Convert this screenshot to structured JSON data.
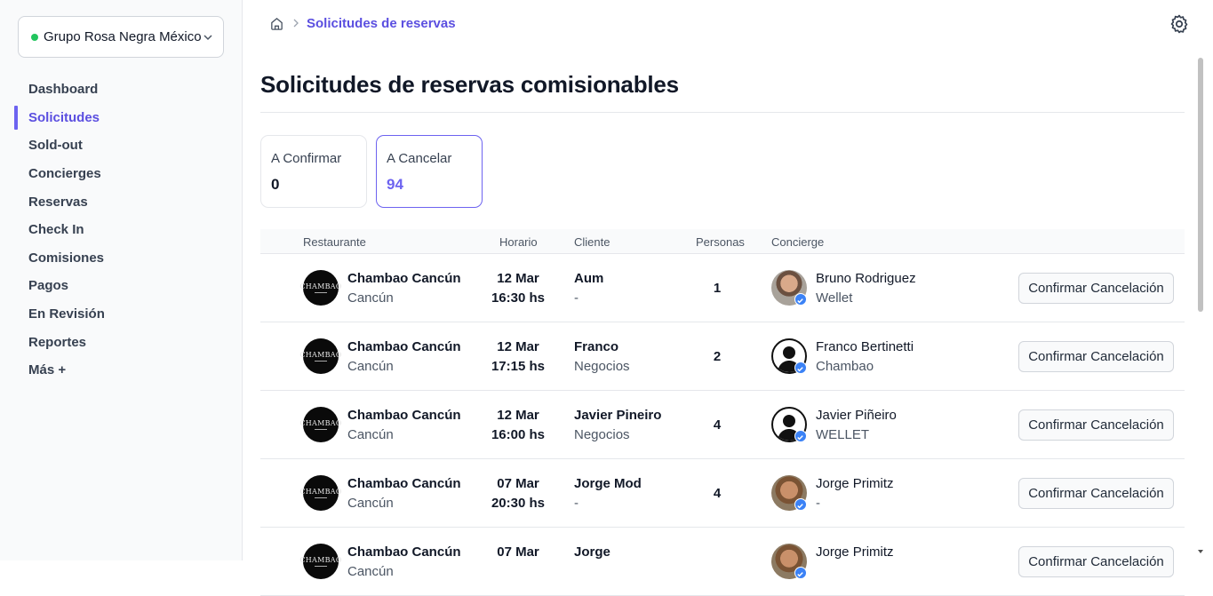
{
  "org": {
    "name": "Grupo Rosa Negra México",
    "status_color": "#22c55e"
  },
  "nav": [
    {
      "label": "Dashboard"
    },
    {
      "label": "Solicitudes",
      "active": true
    },
    {
      "label": "Sold-out"
    },
    {
      "label": "Concierges"
    },
    {
      "label": "Reservas"
    },
    {
      "label": "Check In"
    },
    {
      "label": "Comisiones"
    },
    {
      "label": "Pagos"
    },
    {
      "label": "En Revisión"
    },
    {
      "label": "Reportes"
    },
    {
      "label": "Más +"
    }
  ],
  "breadcrumb": {
    "current": "Solicitudes de reservas"
  },
  "page": {
    "title": "Solicitudes de reservas comisionables"
  },
  "stats": [
    {
      "label": "A Confirmar",
      "value": "0"
    },
    {
      "label": "A Cancelar",
      "value": "94",
      "selected": true
    }
  ],
  "table": {
    "headers": [
      "Restaurante",
      "Horario",
      "Cliente",
      "Personas",
      "Concierge"
    ],
    "logo_text": "CHAMBAO",
    "rows": [
      {
        "restaurant": "Chambao Cancún",
        "city": "Cancún",
        "date": "12 Mar",
        "time": "16:30 hs",
        "client": "Aum",
        "client_sub": "-",
        "persons": "1",
        "concierge": "Bruno Rodriguez",
        "concierge_sub": "Wellet",
        "avatar": "photo",
        "action": "Confirmar Cancelación"
      },
      {
        "restaurant": "Chambao Cancún",
        "city": "Cancún",
        "date": "12 Mar",
        "time": "17:15 hs",
        "client": "Franco",
        "client_sub": "Negocios",
        "persons": "2",
        "concierge": "Franco Bertinetti",
        "concierge_sub": "Chambao",
        "avatar": "default",
        "action": "Confirmar Cancelación"
      },
      {
        "restaurant": "Chambao Cancún",
        "city": "Cancún",
        "date": "12 Mar",
        "time": "16:00 hs",
        "client": "Javier Pineiro",
        "client_sub": "Negocios",
        "persons": "4",
        "concierge": "Javier Piñeiro",
        "concierge_sub": "WELLET",
        "avatar": "default",
        "action": "Confirmar Cancelación"
      },
      {
        "restaurant": "Chambao Cancún",
        "city": "Cancún",
        "date": "07 Mar",
        "time": "20:30 hs",
        "client": "Jorge Mod",
        "client_sub": "-",
        "persons": "4",
        "concierge": "Jorge Primitz",
        "concierge_sub": "-",
        "avatar": "photo2",
        "action": "Confirmar Cancelación"
      },
      {
        "restaurant": "Chambao Cancún",
        "city": "Cancún",
        "date": "07 Mar",
        "time": "",
        "client": "Jorge",
        "client_sub": "",
        "persons": "",
        "concierge": "Jorge Primitz",
        "concierge_sub": "",
        "avatar": "photo2",
        "action": "Confirmar Cancelación"
      }
    ]
  },
  "colors": {
    "accent": "#6d63f0",
    "verified": "#3b82f6"
  }
}
